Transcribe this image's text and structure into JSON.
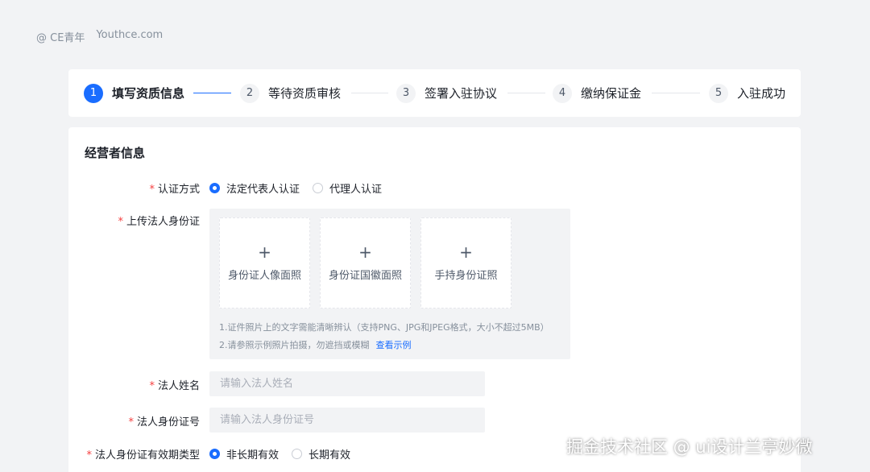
{
  "brand": {
    "at": "@ CE青年",
    "site": "Youthce.com"
  },
  "steps": [
    {
      "num": "1",
      "label": "填写资质信息"
    },
    {
      "num": "2",
      "label": "等待资质审核"
    },
    {
      "num": "3",
      "label": "签署入驻协议"
    },
    {
      "num": "4",
      "label": "缴纳保证金"
    },
    {
      "num": "5",
      "label": "入驻成功"
    }
  ],
  "form": {
    "section_title": "经营者信息",
    "auth": {
      "label": "认证方式",
      "options": [
        "法定代表人认证",
        "代理人认证"
      ],
      "selected": "法定代表人认证"
    },
    "upload": {
      "label": "上传法人身份证",
      "slots": [
        "身份证人像面照",
        "身份证国徽面照",
        "手持身份证照"
      ],
      "plus": "+",
      "hint1": "1.证件照片上的文字需能清晰辨认（支持PNG、JPG和JPEG格式，大小不超过5MB）",
      "hint2": "2.请参照示例照片拍摄，勿遮挡或模糊",
      "example_link": "查看示例"
    },
    "name": {
      "label": "法人姓名",
      "placeholder": "请输入法人姓名"
    },
    "id_number": {
      "label": "法人身份证号",
      "placeholder": "请输入法人身份证号"
    },
    "validity": {
      "label": "法人身份证有效期类型",
      "options": [
        "非长期有效",
        "长期有效"
      ],
      "selected": "非长期有效"
    }
  },
  "watermark": "掘金技术社区 @ ui设计兰亭妙微",
  "colors": {
    "accent": "#1a6dff",
    "required": "#f53f3f",
    "background": "#f2f3f5"
  }
}
